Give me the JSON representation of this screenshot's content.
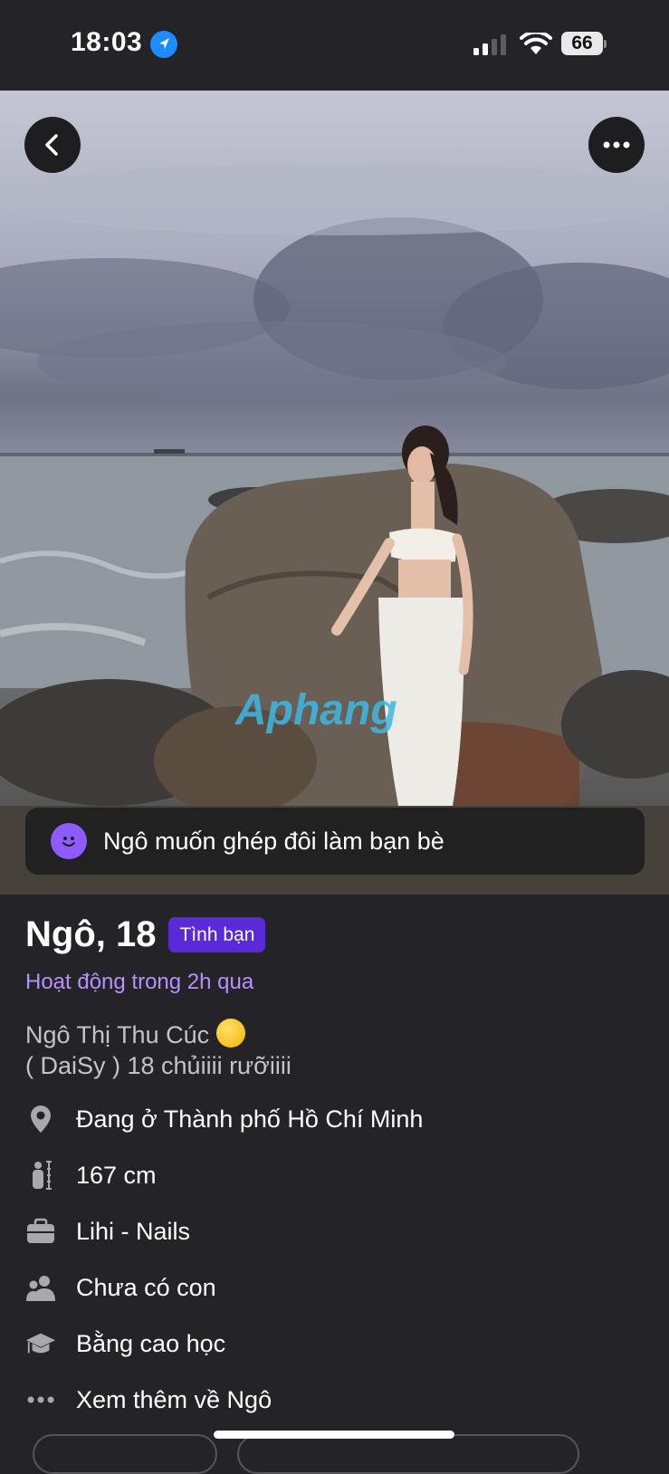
{
  "status_bar": {
    "time": "18:03",
    "battery": "66"
  },
  "photo": {
    "watermark": "Aphang"
  },
  "match_banner": {
    "text": "Ngô muốn ghép đôi làm bạn bè"
  },
  "profile": {
    "name_age": "Ngô, 18",
    "badge": "Tình bạn",
    "activity": "Hoạt động trong 2h qua",
    "bio_line1": "Ngô Thị Thu Cúc",
    "bio_line2": "( DaiSy ) 18 chủiiii rưỡiiii"
  },
  "details": [
    {
      "icon": "location-pin-icon",
      "text": "Đang ở Thành phố Hồ Chí Minh"
    },
    {
      "icon": "height-icon",
      "text": "167 cm"
    },
    {
      "icon": "briefcase-icon",
      "text": "Lihi - Nails"
    },
    {
      "icon": "children-icon",
      "text": "Chưa có con"
    },
    {
      "icon": "graduation-cap-icon",
      "text": "Bằng cao học"
    },
    {
      "icon": "more-dots-icon",
      "text": "Xem thêm về Ngô"
    }
  ],
  "colors": {
    "background": "#242428",
    "accent_purple": "#5b2ad8",
    "activity_purple": "#b690ff"
  }
}
